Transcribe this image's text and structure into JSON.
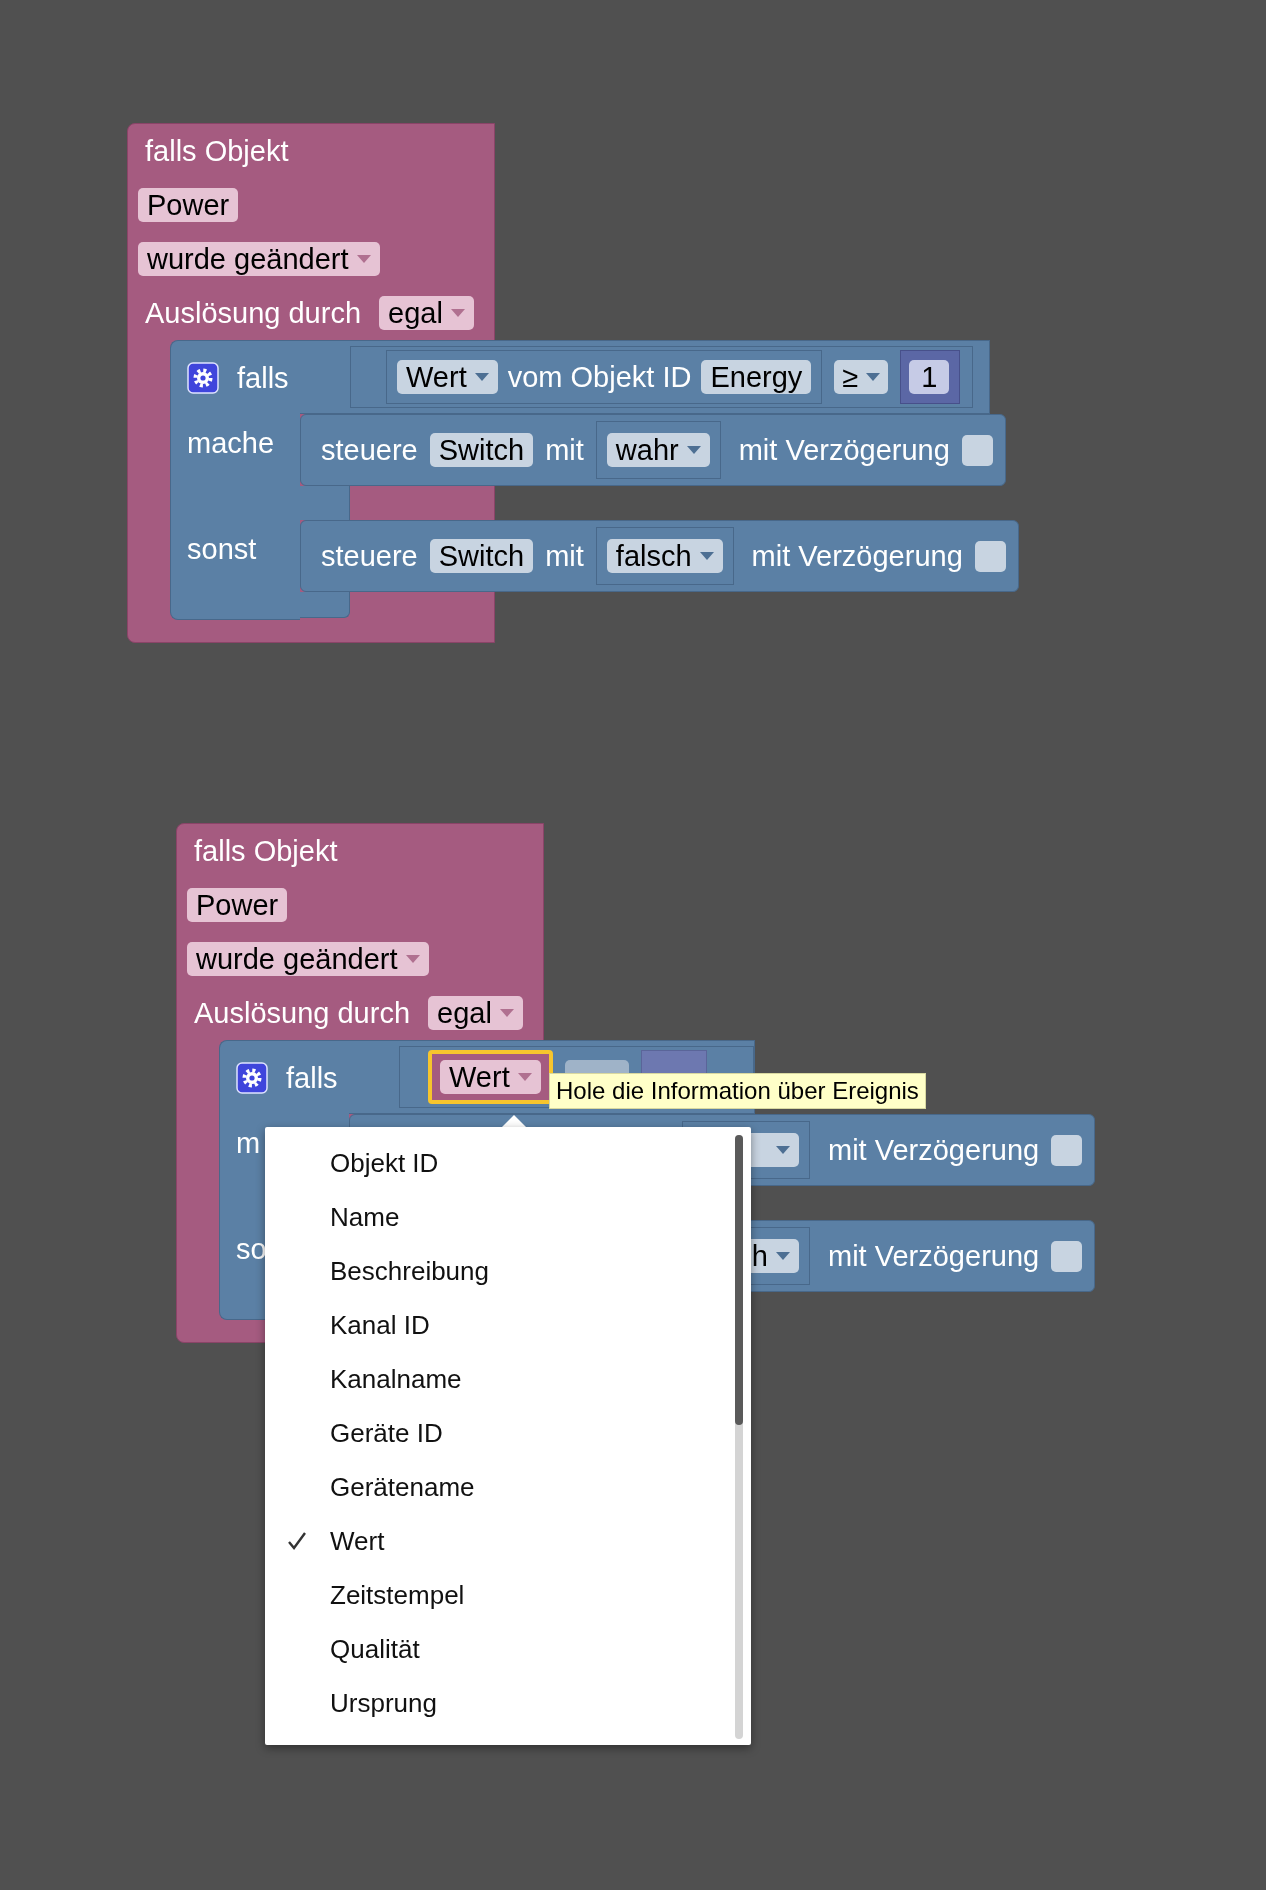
{
  "scenes": [
    {
      "trigger": {
        "title": "falls Objekt",
        "object": "Power",
        "event": "wurde geändert",
        "trigger_label": "Auslösung durch",
        "trigger_value": "egal"
      },
      "if_block": {
        "if_label": "falls",
        "condition": {
          "kind": "object_value",
          "attribute": "Wert",
          "middle": "vom Objekt ID",
          "object": "Energy",
          "operator": "≥",
          "number": "1"
        },
        "branches": [
          {
            "label": "mache",
            "action": {
              "covered": false,
              "verb": "steuere",
              "target": "Switch",
              "with": "mit",
              "value": "wahr",
              "delay_label": "mit Verzögerung",
              "checked": false
            }
          },
          {
            "label": "sonst",
            "action": {
              "covered": false,
              "verb": "steuere",
              "target": "Switch",
              "with": "mit",
              "value": "falsch",
              "delay_label": "mit Verzögerung",
              "checked": false
            }
          }
        ]
      }
    },
    {
      "trigger": {
        "title": "falls Objekt",
        "object": "Power",
        "event": "wurde geändert",
        "trigger_label": "Auslösung durch",
        "trigger_value": "egal"
      },
      "if_block": {
        "if_label": "falls",
        "condition": {
          "kind": "event_info",
          "attribute": "Wert",
          "highlighted": true,
          "faded_operands": true
        },
        "branches": [
          {
            "label": "m",
            "action": {
              "covered": true,
              "delay_label": "mit Verzögerung",
              "checked": false
            }
          },
          {
            "label": "so",
            "action": {
              "covered": true,
              "value": "h",
              "delay_label": "mit Verzögerung",
              "checked": false
            }
          }
        ]
      }
    }
  ],
  "tooltip": "Hole die Information über Ereignis",
  "menu": {
    "items": [
      {
        "label": "Objekt ID",
        "selected": false
      },
      {
        "label": "Name",
        "selected": false
      },
      {
        "label": "Beschreibung",
        "selected": false
      },
      {
        "label": "Kanal ID",
        "selected": false
      },
      {
        "label": "Kanalname",
        "selected": false
      },
      {
        "label": "Geräte ID",
        "selected": false
      },
      {
        "label": "Gerätename",
        "selected": false
      },
      {
        "label": "Wert",
        "selected": true
      },
      {
        "label": "Zeitstempel",
        "selected": false
      },
      {
        "label": "Qualität",
        "selected": false
      },
      {
        "label": "Ursprung",
        "selected": false
      }
    ]
  }
}
